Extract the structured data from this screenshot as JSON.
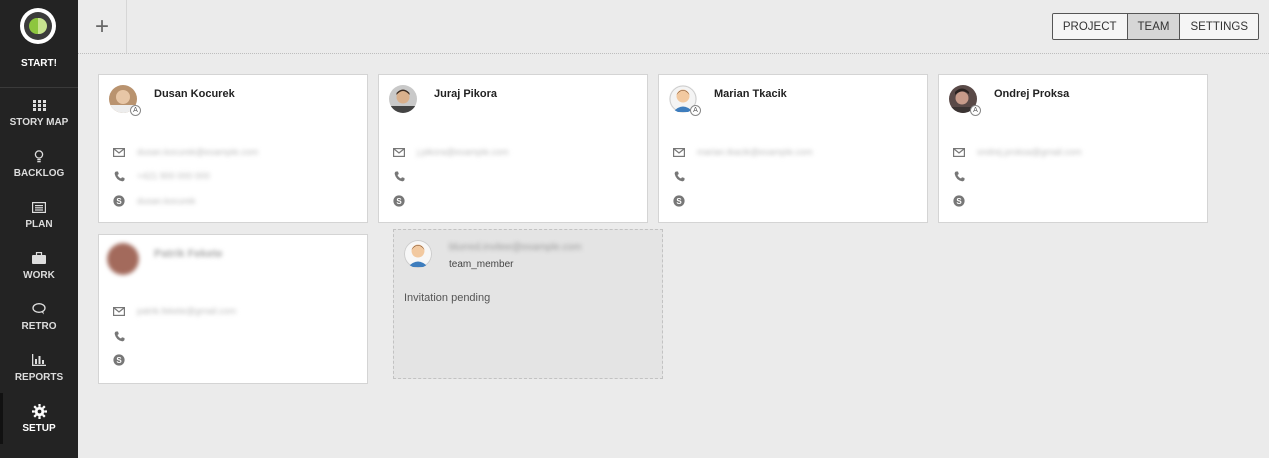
{
  "app": {
    "logo_label": "START!",
    "accent": "#8dc63f"
  },
  "nav": [
    {
      "label": "STORY MAP",
      "icon": "grid-icon"
    },
    {
      "label": "BACKLOG",
      "icon": "lightbulb-icon"
    },
    {
      "label": "PLAN",
      "icon": "list-icon"
    },
    {
      "label": "WORK",
      "icon": "briefcase-icon"
    },
    {
      "label": "RETRO",
      "icon": "chat-icon"
    },
    {
      "label": "REPORTS",
      "icon": "bar-chart-icon"
    },
    {
      "label": "SETUP",
      "icon": "gear-icon",
      "active": true
    }
  ],
  "topbar": {
    "add_label": "+",
    "tabs": [
      {
        "label": "PROJECT"
      },
      {
        "label": "TEAM",
        "active": true
      },
      {
        "label": "SETTINGS"
      }
    ]
  },
  "members": [
    {
      "name": "Dusan Kocurek",
      "badge": "A",
      "email": "dusan.kocurek@example.com",
      "phone": "+421 900 000 000",
      "skype": "dusan.kocurek"
    },
    {
      "name": "Juraj Pikora",
      "email": "j.pikora@example.com",
      "phone": "",
      "skype": ""
    },
    {
      "name": "Marian Tkacik",
      "badge": "A",
      "email": "marian.tkacik@example.com",
      "phone": "",
      "skype": ""
    },
    {
      "name": "Ondrej Proksa",
      "badge": "A",
      "email": "ondrej.proksa@gmail.com",
      "phone": "",
      "skype": ""
    },
    {
      "name": "Patrik Fekete",
      "email": "patrik.fekete@gmail.com",
      "phone": "",
      "skype": ""
    }
  ],
  "invitation": {
    "email": "blurred.invitee@example.com",
    "role": "team_member",
    "status": "Invitation pending"
  }
}
